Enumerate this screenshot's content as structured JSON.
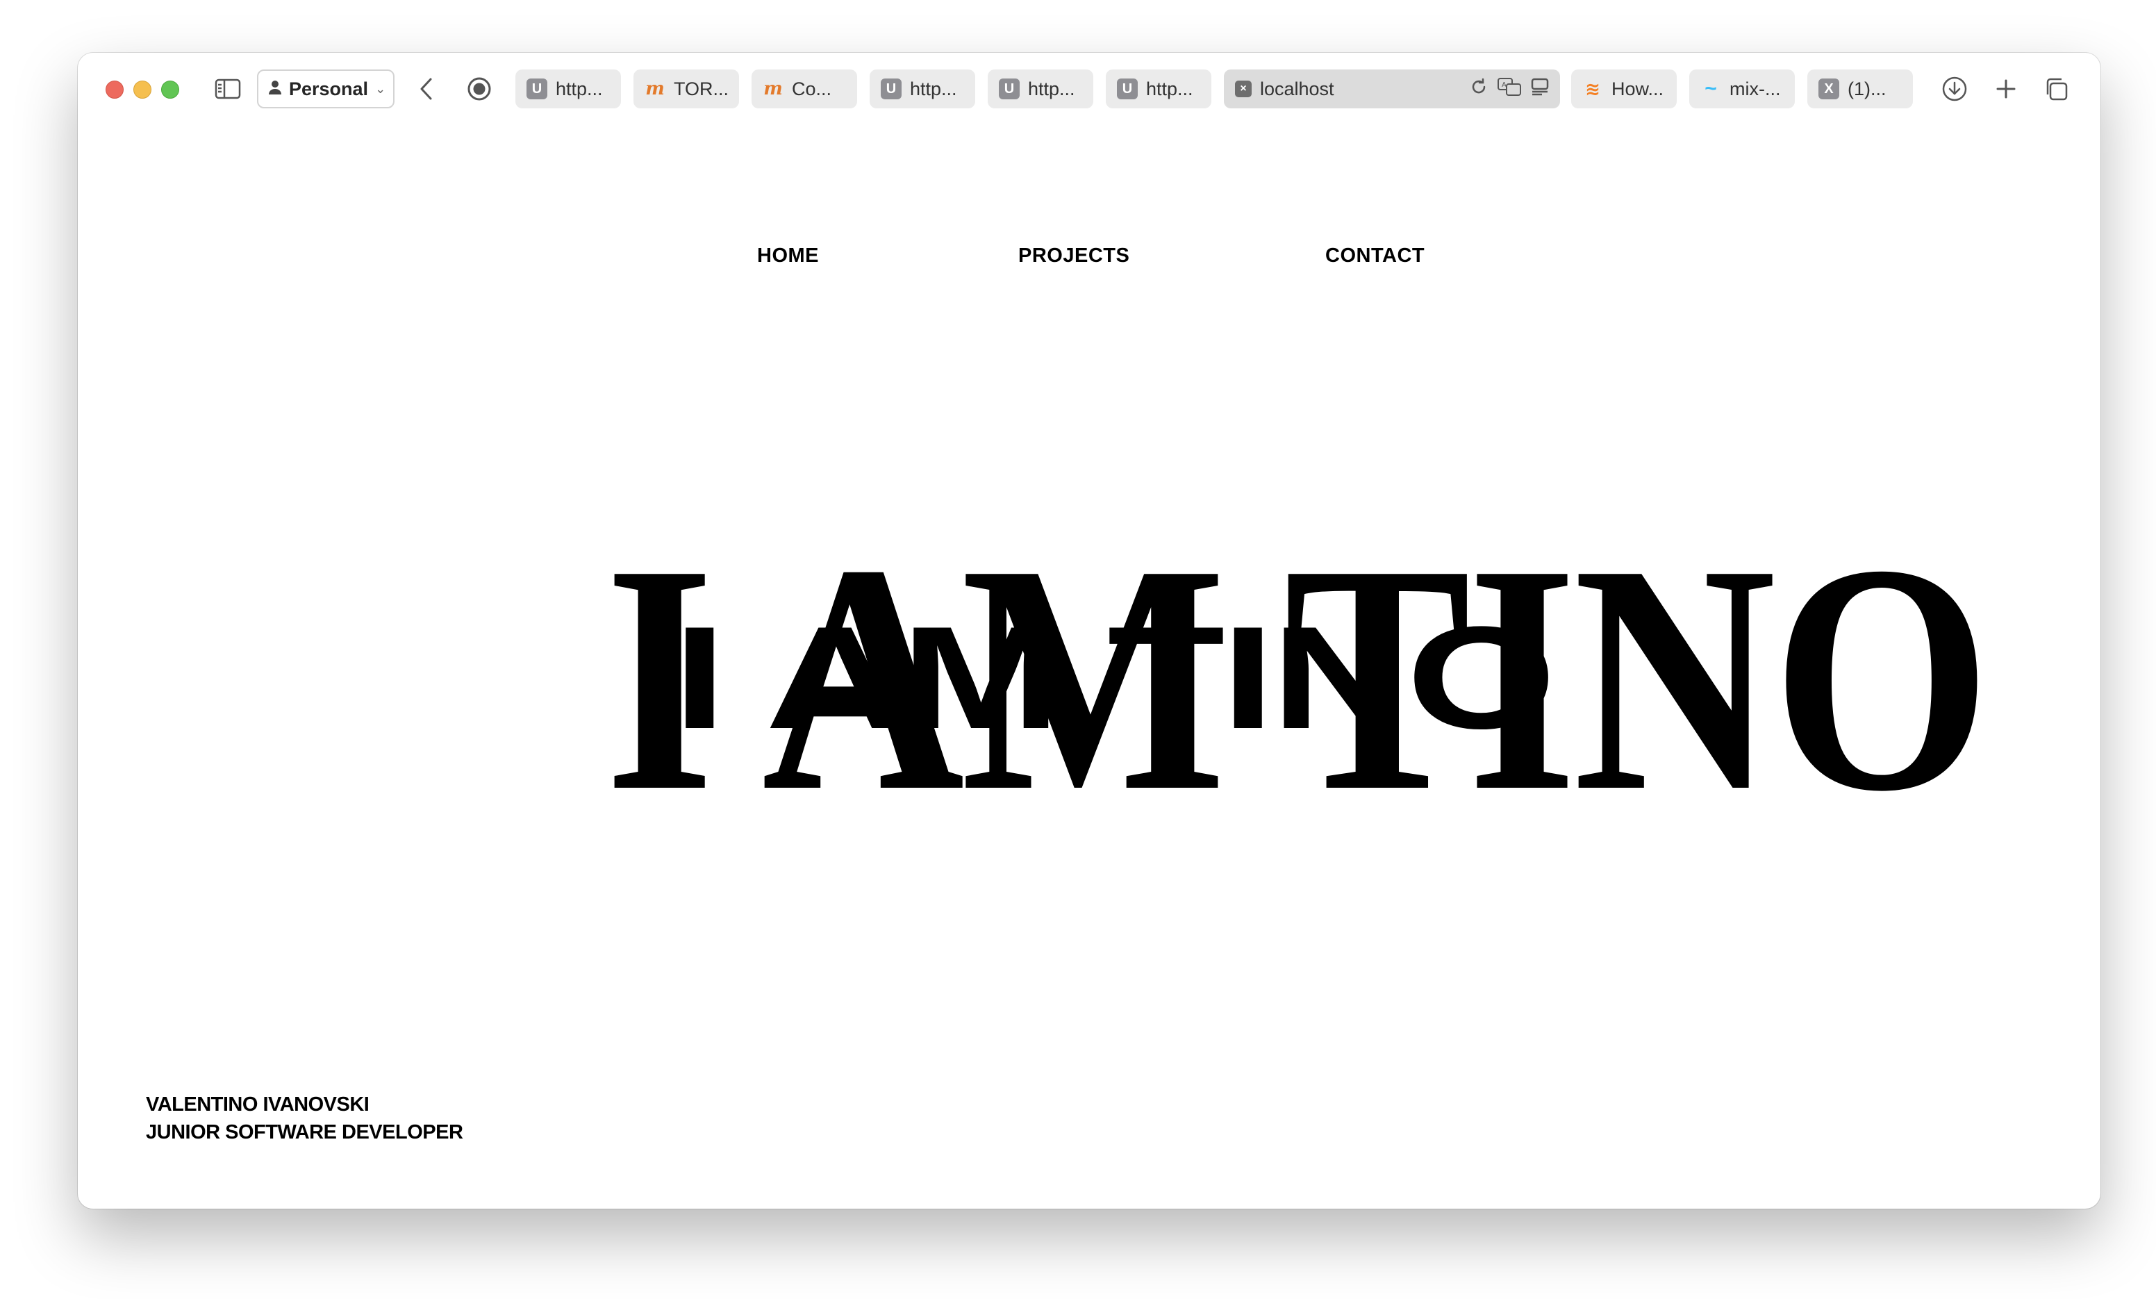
{
  "browser": {
    "profile_label": "Personal",
    "tabs": [
      {
        "label": "http...",
        "favicon": "U"
      },
      {
        "label": "TOR...",
        "favicon": "m"
      },
      {
        "label": "Co...",
        "favicon": "m"
      },
      {
        "label": "http...",
        "favicon": "U"
      },
      {
        "label": "http...",
        "favicon": "U"
      },
      {
        "label": "http...",
        "favicon": "U"
      },
      {
        "label": "localhost",
        "favicon": "×"
      },
      {
        "label": "How...",
        "favicon": "≋"
      },
      {
        "label": "mix-...",
        "favicon": "~"
      },
      {
        "label": "(1)...",
        "favicon": "X"
      }
    ]
  },
  "nav": {
    "home": "HOME",
    "projects": "PROJECTS",
    "contact": "CONTACT"
  },
  "hero": {
    "headline": "I AM TINO"
  },
  "footer": {
    "name": "VALENTINO IVANOVSKI",
    "role": "JUNIOR SOFTWARE DEVELOPER"
  }
}
